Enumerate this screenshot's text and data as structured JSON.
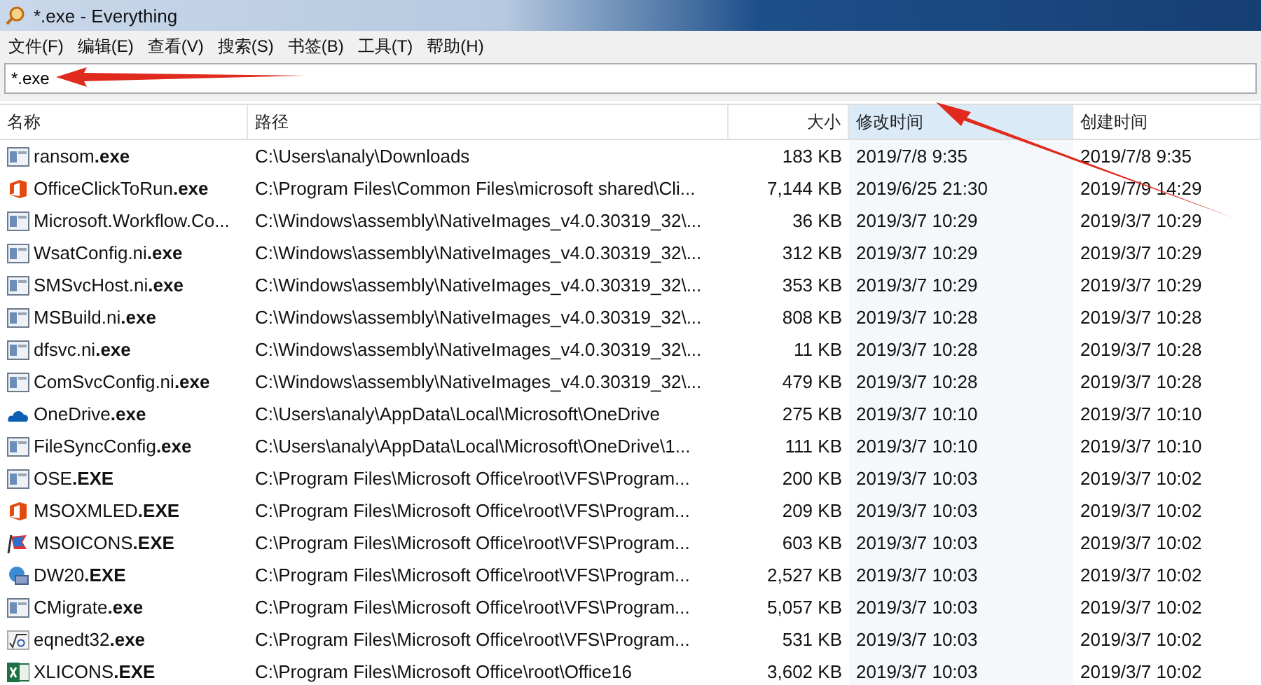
{
  "window": {
    "title": "*.exe - Everything"
  },
  "menu": [
    "文件(F)",
    "编辑(E)",
    "查看(V)",
    "搜索(S)",
    "书签(B)",
    "工具(T)",
    "帮助(H)"
  ],
  "search": {
    "value": "*.exe"
  },
  "table": {
    "columns": [
      {
        "label": "名称",
        "sorted": false
      },
      {
        "label": "路径",
        "sorted": false
      },
      {
        "label": "大小",
        "sorted": false
      },
      {
        "label": "修改时间",
        "sorted": true
      },
      {
        "label": "创建时间",
        "sorted": false
      }
    ],
    "rows": [
      {
        "kind": "app",
        "name": "ransom**.exe**",
        "path": "C:\\Users\\analy\\Downloads",
        "size": "183 KB",
        "modified": "2019/7/8 9:35",
        "created": "2019/7/8 9:35"
      },
      {
        "kind": "office",
        "name": "OfficeClickToRun**.exe**",
        "path": "C:\\Program Files\\Common Files\\microsoft shared\\Cli...",
        "size": "7,144 KB",
        "modified": "2019/6/25 21:30",
        "created": "2019/7/9 14:29"
      },
      {
        "kind": "app",
        "name": "Microsoft.Workflow.Co...",
        "path": "C:\\Windows\\assembly\\NativeImages_v4.0.30319_32\\...",
        "size": "36 KB",
        "modified": "2019/3/7 10:29",
        "created": "2019/3/7 10:29"
      },
      {
        "kind": "app",
        "name": "WsatConfig.ni**.exe**",
        "path": "C:\\Windows\\assembly\\NativeImages_v4.0.30319_32\\...",
        "size": "312 KB",
        "modified": "2019/3/7 10:29",
        "created": "2019/3/7 10:29"
      },
      {
        "kind": "app",
        "name": "SMSvcHost.ni**.exe**",
        "path": "C:\\Windows\\assembly\\NativeImages_v4.0.30319_32\\...",
        "size": "353 KB",
        "modified": "2019/3/7 10:29",
        "created": "2019/3/7 10:29"
      },
      {
        "kind": "app",
        "name": "MSBuild.ni**.exe**",
        "path": "C:\\Windows\\assembly\\NativeImages_v4.0.30319_32\\...",
        "size": "808 KB",
        "modified": "2019/3/7 10:28",
        "created": "2019/3/7 10:28"
      },
      {
        "kind": "app",
        "name": "dfsvc.ni**.exe**",
        "path": "C:\\Windows\\assembly\\NativeImages_v4.0.30319_32\\...",
        "size": "11 KB",
        "modified": "2019/3/7 10:28",
        "created": "2019/3/7 10:28"
      },
      {
        "kind": "app",
        "name": "ComSvcConfig.ni**.exe**",
        "path": "C:\\Windows\\assembly\\NativeImages_v4.0.30319_32\\...",
        "size": "479 KB",
        "modified": "2019/3/7 10:28",
        "created": "2019/3/7 10:28"
      },
      {
        "kind": "cloud",
        "name": "OneDrive**.exe**",
        "path": "C:\\Users\\analy\\AppData\\Local\\Microsoft\\OneDrive",
        "size": "275 KB",
        "modified": "2019/3/7 10:10",
        "created": "2019/3/7 10:10"
      },
      {
        "kind": "app",
        "name": "FileSyncConfig**.exe**",
        "path": "C:\\Users\\analy\\AppData\\Local\\Microsoft\\OneDrive\\1...",
        "size": "111 KB",
        "modified": "2019/3/7 10:10",
        "created": "2019/3/7 10:10"
      },
      {
        "kind": "app",
        "name": "OSE**.EXE**",
        "path": "C:\\Program Files\\Microsoft Office\\root\\VFS\\Program...",
        "size": "200 KB",
        "modified": "2019/3/7 10:03",
        "created": "2019/3/7 10:02"
      },
      {
        "kind": "office",
        "name": "MSOXMLED**.EXE**",
        "path": "C:\\Program Files\\Microsoft Office\\root\\VFS\\Program...",
        "size": "209 KB",
        "modified": "2019/3/7 10:03",
        "created": "2019/3/7 10:02"
      },
      {
        "kind": "flag",
        "name": "MSOICONS**.EXE**",
        "path": "C:\\Program Files\\Microsoft Office\\root\\VFS\\Program...",
        "size": "603 KB",
        "modified": "2019/3/7 10:03",
        "created": "2019/3/7 10:02"
      },
      {
        "kind": "globe",
        "name": "DW20**.EXE**",
        "path": "C:\\Program Files\\Microsoft Office\\root\\VFS\\Program...",
        "size": "2,527 KB",
        "modified": "2019/3/7 10:03",
        "created": "2019/3/7 10:02"
      },
      {
        "kind": "app",
        "name": "CMigrate**.exe**",
        "path": "C:\\Program Files\\Microsoft Office\\root\\VFS\\Program...",
        "size": "5,057 KB",
        "modified": "2019/3/7 10:03",
        "created": "2019/3/7 10:02"
      },
      {
        "kind": "equation",
        "name": "eqnedt32**.exe**",
        "path": "C:\\Program Files\\Microsoft Office\\root\\VFS\\Program...",
        "size": "531 KB",
        "modified": "2019/3/7 10:03",
        "created": "2019/3/7 10:02"
      },
      {
        "kind": "sheet",
        "name": "XLICONS**.EXE**",
        "path": "C:\\Program Files\\Microsoft Office\\root\\Office16",
        "size": "3,602 KB",
        "modified": "2019/3/7 10:03",
        "created": "2019/3/7 10:02"
      }
    ]
  }
}
